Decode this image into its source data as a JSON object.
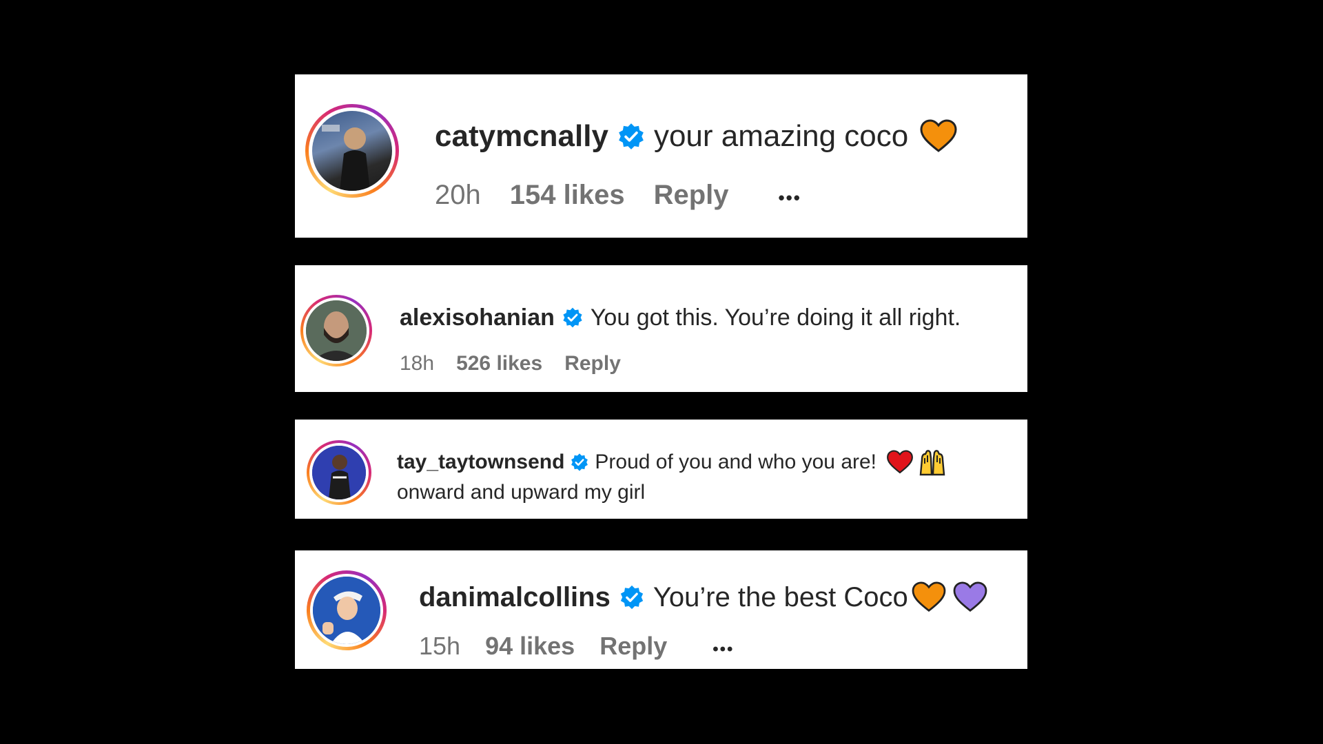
{
  "colors": {
    "background": "#000000",
    "card": "#ffffff",
    "text": "#262626",
    "meta": "#737373",
    "verified": "#0095f6"
  },
  "comments": [
    {
      "username": "catymcnally",
      "verified": true,
      "text": "your amazing coco",
      "emojis": [
        "orange-heart"
      ],
      "time": "20h",
      "likes": "154 likes",
      "reply": "Reply",
      "more": "•••"
    },
    {
      "username": "alexisohanian",
      "verified": true,
      "text": "You got this. You’re doing it all right.",
      "emojis": [],
      "time": "18h",
      "likes": "526 likes",
      "reply": "Reply"
    },
    {
      "username": "tay_taytownsend",
      "verified": true,
      "text": "Proud of you and who you are!",
      "text_line2": "onward and upward my girl",
      "emojis": [
        "red-heart",
        "raising-hands"
      ]
    },
    {
      "username": "danimalcollins",
      "verified": true,
      "text": "You’re the best Coco",
      "emojis": [
        "orange-heart",
        "purple-heart"
      ],
      "time": "15h",
      "likes": "94 likes",
      "reply": "Reply",
      "more": "•••"
    }
  ]
}
